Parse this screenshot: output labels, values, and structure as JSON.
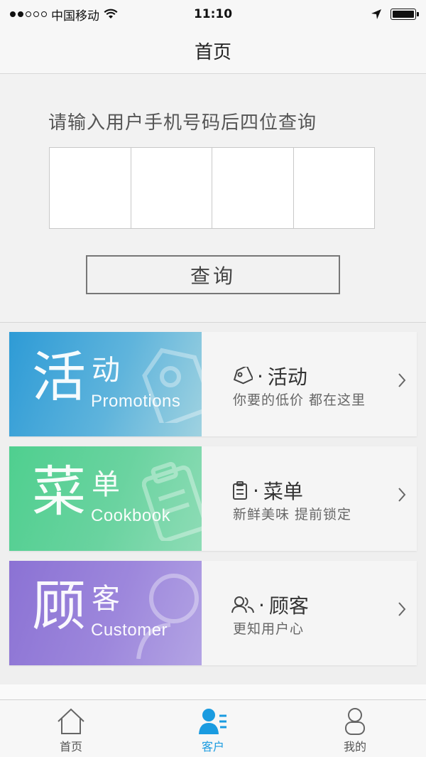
{
  "status_bar": {
    "carrier": "中国移动",
    "time": "11:10",
    "signal_bars_filled": 2,
    "signal_bars_total": 5
  },
  "nav": {
    "title": "首页"
  },
  "query": {
    "prompt": "请输入用户手机号码后四位查询",
    "digits": [
      "",
      "",
      "",
      ""
    ],
    "button_label": "查询"
  },
  "cards": [
    {
      "banner_big": "活",
      "banner_small": "动",
      "banner_en": "Promotions",
      "title": "活动",
      "subtitle": "你要的低价 都在这里",
      "icon": "tag-icon",
      "color": "#2e9bd6"
    },
    {
      "banner_big": "菜",
      "banner_small": "单",
      "banner_en": "Cookbook",
      "title": "菜单",
      "subtitle": "新鲜美味 提前锁定",
      "icon": "clipboard-icon",
      "color": "#4fcf8f"
    },
    {
      "banner_big": "顾",
      "banner_small": "客",
      "banner_en": "Customer",
      "title": "顾客",
      "subtitle": "更知用户心",
      "icon": "users-icon",
      "color": "#8b72d4"
    }
  ],
  "tabs": [
    {
      "label": "首页",
      "icon": "home-icon",
      "active": false
    },
    {
      "label": "客户",
      "icon": "customer-icon",
      "active": true
    },
    {
      "label": "我的",
      "icon": "profile-icon",
      "active": false
    }
  ],
  "colors": {
    "accent": "#1a9be0",
    "background": "#efefef"
  }
}
